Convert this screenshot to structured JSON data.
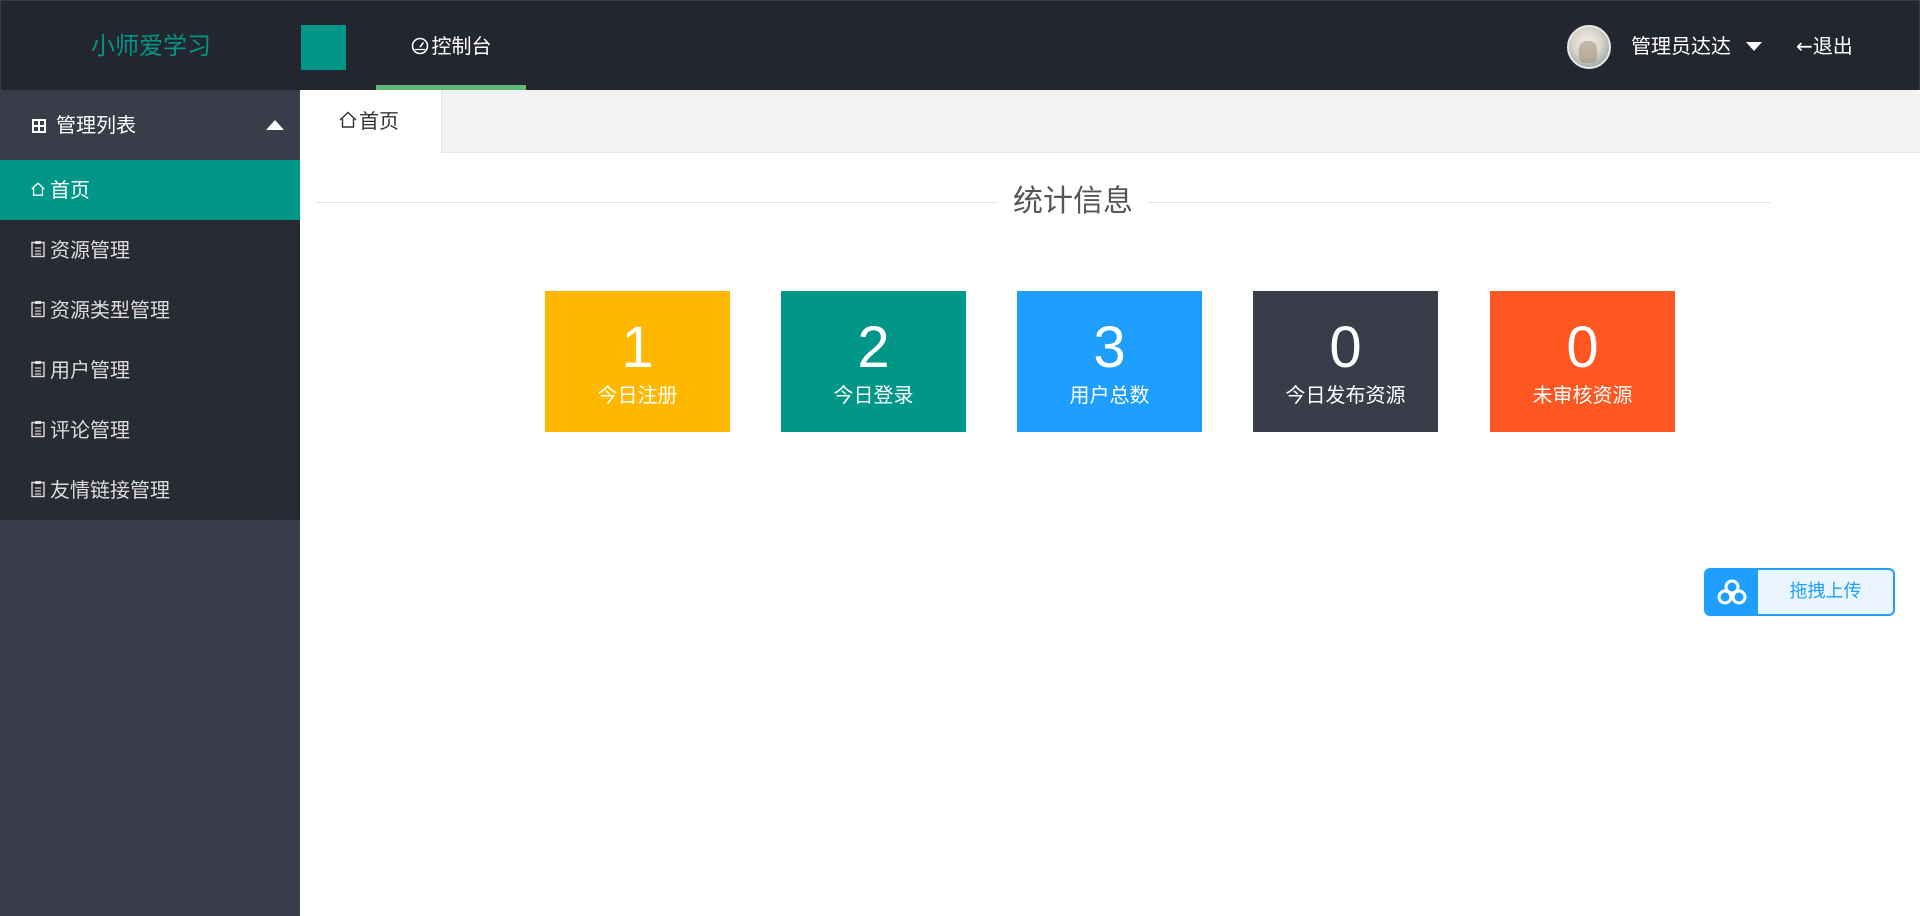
{
  "header": {
    "logo": "小师爱学习",
    "nav_console_label": "控制台",
    "admin_name": "管理员达达",
    "logout_label": "←退出"
  },
  "sidebar": {
    "heading": "管理列表",
    "items": [
      {
        "label": "首页",
        "icon": "home-icon",
        "active": true
      },
      {
        "label": "资源管理",
        "icon": "clipboard-icon"
      },
      {
        "label": "资源类型管理",
        "icon": "clipboard-icon"
      },
      {
        "label": "用户管理",
        "icon": "clipboard-icon"
      },
      {
        "label": "评论管理",
        "icon": "clipboard-icon"
      },
      {
        "label": "友情链接管理",
        "icon": "clipboard-icon"
      }
    ]
  },
  "tabs": {
    "home_label": "首页"
  },
  "stats": {
    "title": "统计信息",
    "cards": [
      {
        "value": "1",
        "label": "今日注册",
        "color": "#ffb800"
      },
      {
        "value": "2",
        "label": "今日登录",
        "color": "#009688"
      },
      {
        "value": "3",
        "label": "用户总数",
        "color": "#1e9fff"
      },
      {
        "value": "0",
        "label": "今日发布资源",
        "color": "#393d49"
      },
      {
        "value": "0",
        "label": "未审核资源",
        "color": "#ff5722"
      }
    ]
  },
  "upload_widget": {
    "label": "拖拽上传"
  },
  "colors": {
    "header_bg": "#23262e",
    "sidebar_bg": "#393d49",
    "accent": "#009688",
    "active_tab_bar": "#5fb878"
  }
}
